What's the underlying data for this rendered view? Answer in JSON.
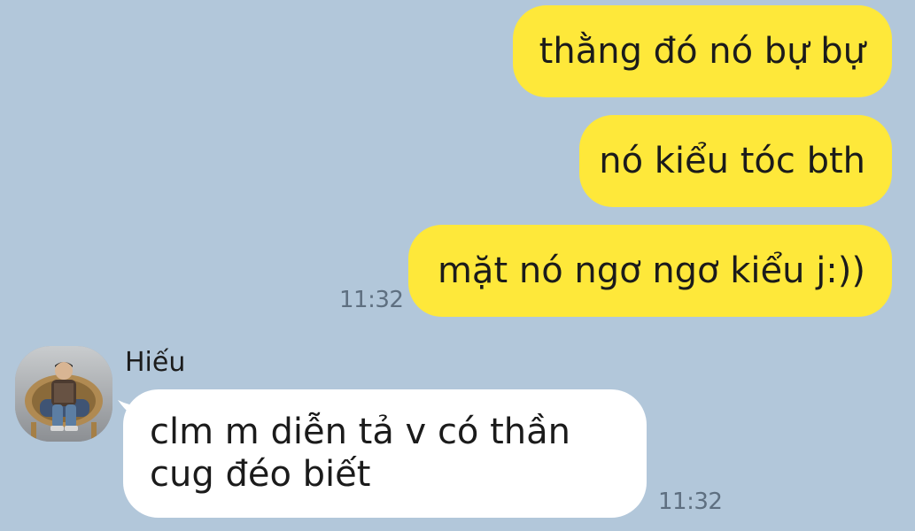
{
  "conversation": {
    "outgoing": [
      {
        "text": "thằng đó nó bự bự"
      },
      {
        "text": "nó kiểu tóc bth"
      },
      {
        "text": "mặt nó ngơ ngơ kiểu j:))"
      }
    ],
    "outgoing_time": "11:32",
    "incoming": {
      "sender": "Hiếu",
      "lines": [
        "clm m diễn tả v có thần",
        "cug đéo biết"
      ],
      "time": "11:32"
    }
  },
  "colors": {
    "background": "#b2c7da",
    "outgoing_bubble": "#fee83a",
    "incoming_bubble": "#ffffff",
    "timestamp": "#5e6f80"
  },
  "icons": {
    "avatar": "user-photo-avatar"
  }
}
